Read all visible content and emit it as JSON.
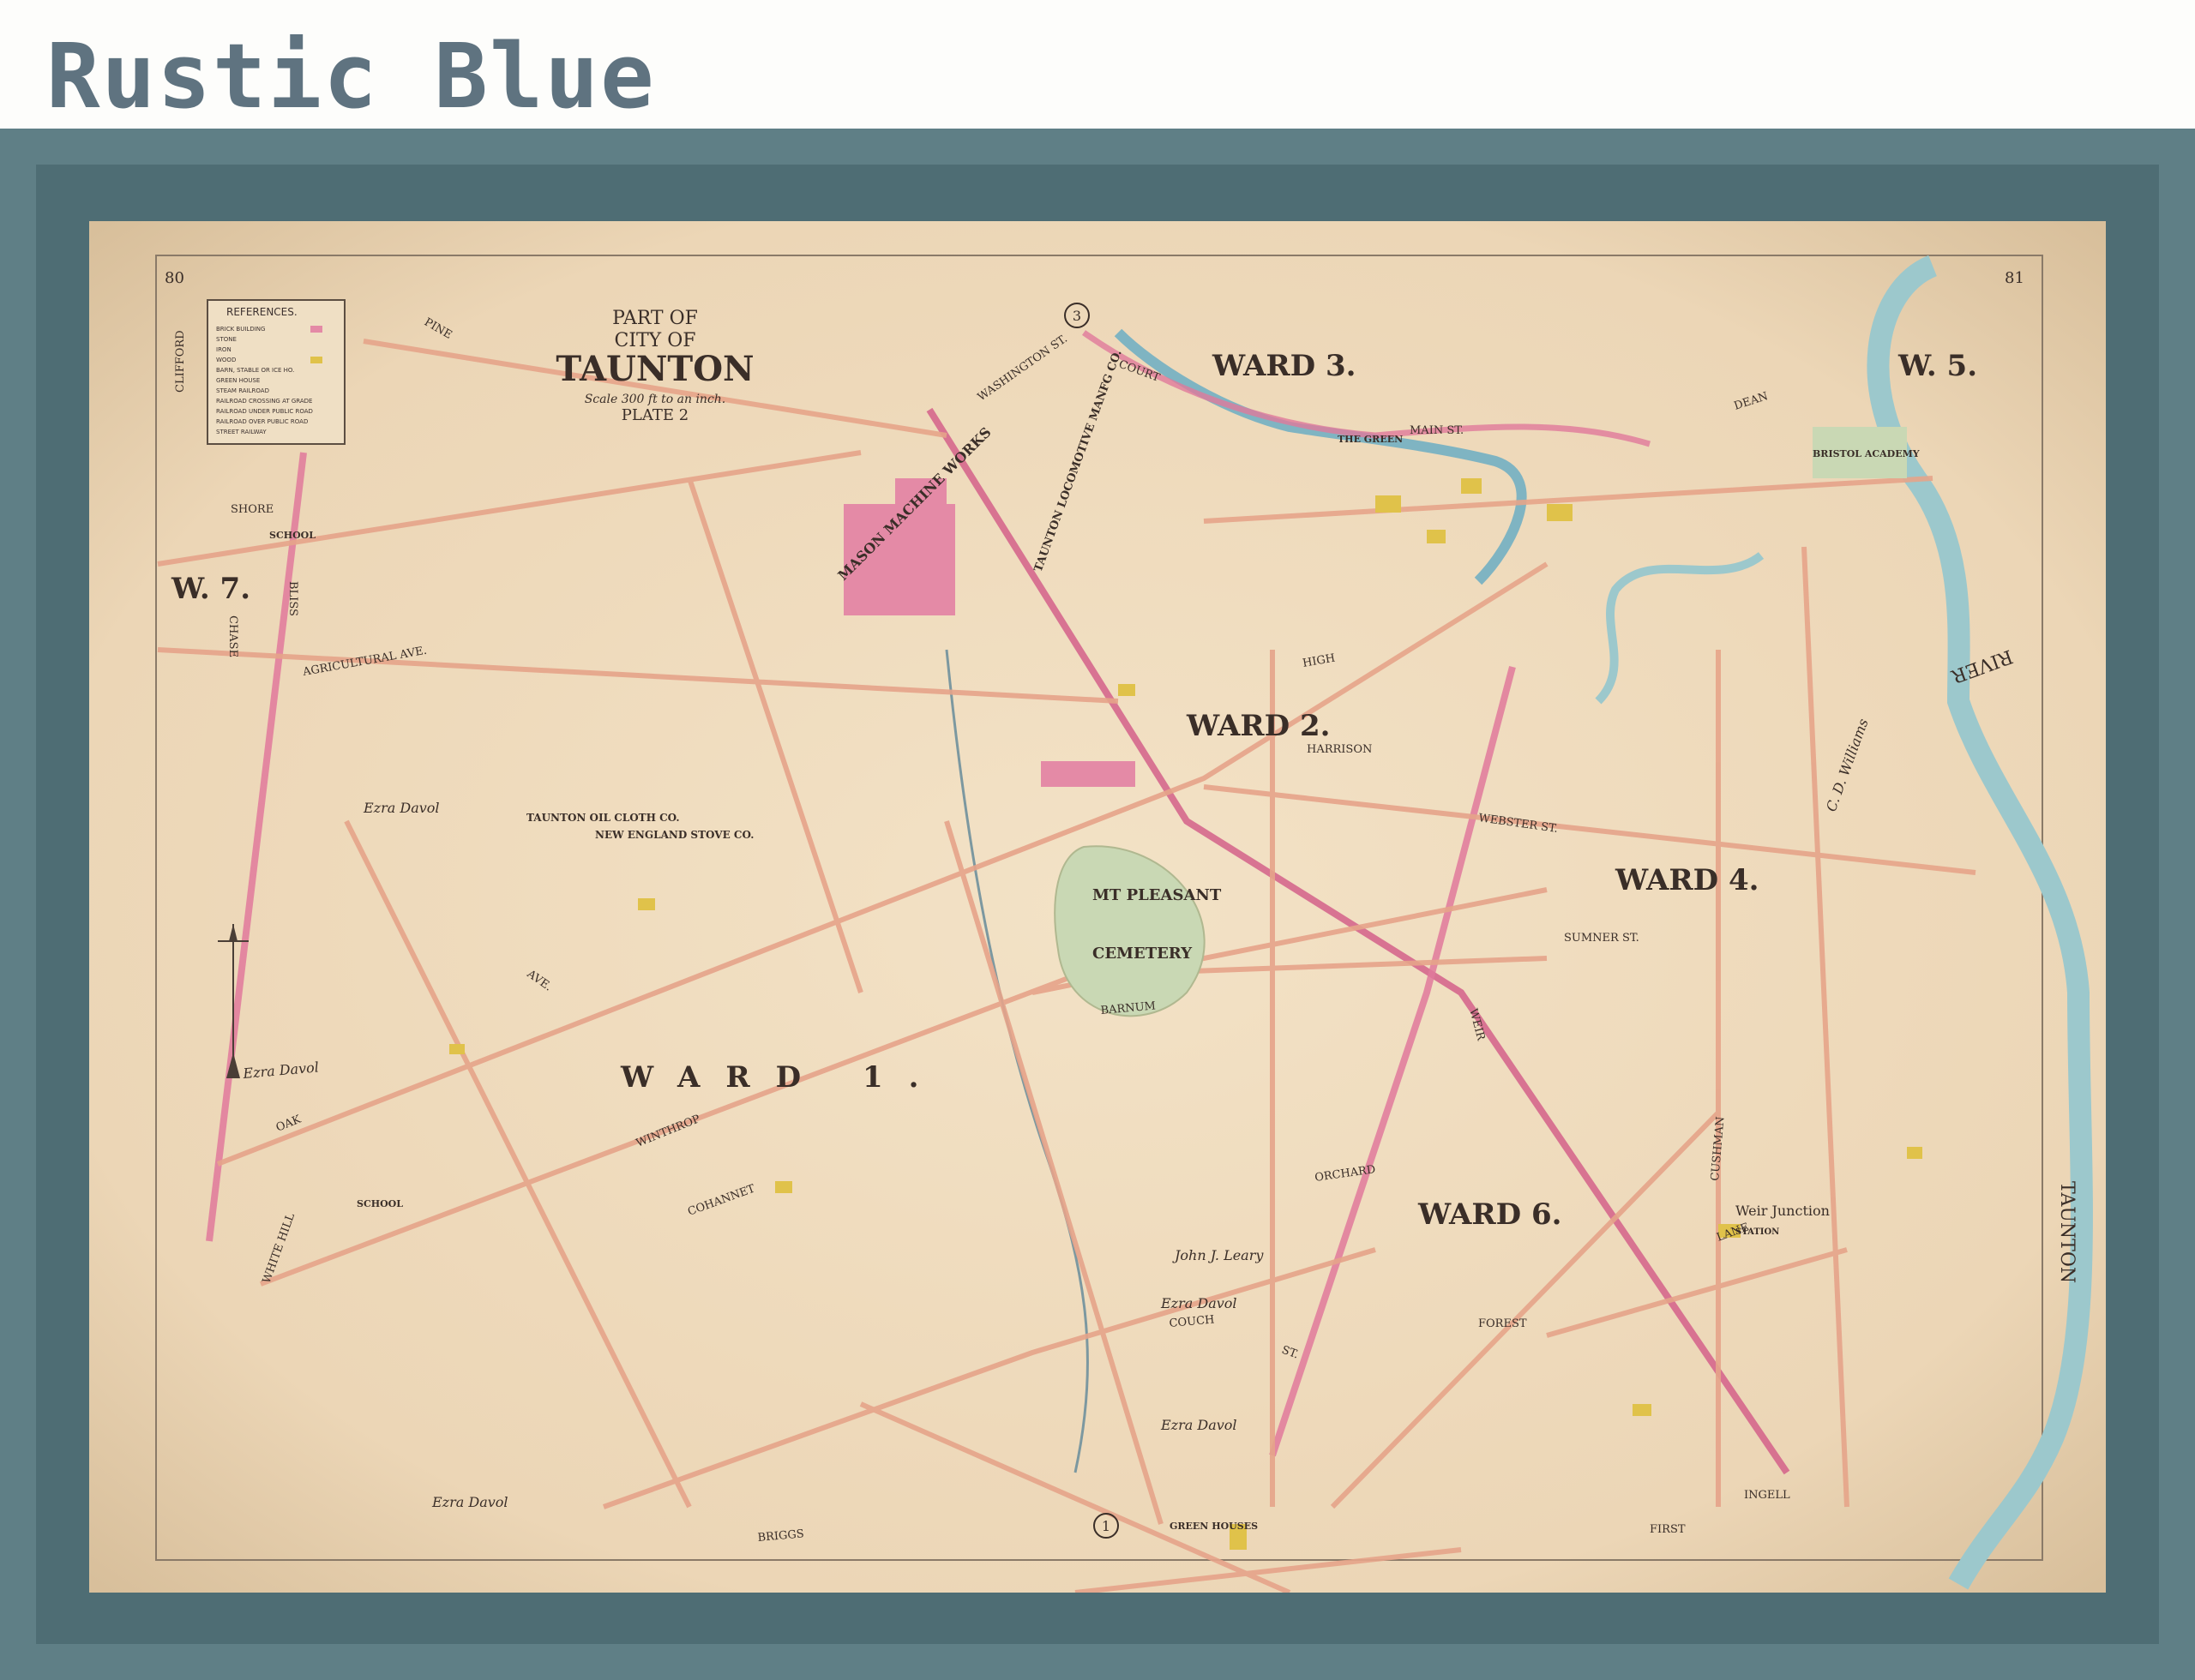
{
  "caption": "Rustic Blue",
  "map": {
    "title_line1": "PART OF",
    "title_line2": "CITY OF",
    "title_line3": "TAUNTON",
    "scale": "Scale 300 ft to an inch.",
    "plate": "PLATE 2",
    "page_left": "80",
    "page_right": "81",
    "legend": {
      "title": "REFERENCES.",
      "items": [
        "BRICK BUILDING",
        "STONE",
        "IRON",
        "WOOD",
        "BARN, STABLE OR ICE HO.",
        "GREEN HOUSE",
        "STEAM RAILROAD",
        "RAILROAD CROSSING AT GRADE",
        "RAILROAD UNDER PUBLIC ROAD",
        "RAILROAD OVER PUBLIC ROAD",
        "STREET RAILWAY"
      ]
    },
    "wards": [
      "WARD 3.",
      "W. 5.",
      "W. 7.",
      "WARD 2.",
      "WARD 4.",
      "WARD 1.",
      "WARD 6."
    ],
    "places": [
      "MASON MACHINE WORKS",
      "TAUNTON LOCOMOTIVE MANFG CO.",
      "BRISTOL ACADEMY",
      "TAUNTON OIL CLOTH CO.",
      "NEW ENGLAND STOVE CO.",
      "MT PLEASANT",
      "CEMETERY",
      "Weir Junction",
      "STATION",
      "SCHOOL",
      "SCHOOL",
      "GREEN HOUSES",
      "THE GREEN"
    ],
    "streets": [
      "PINE",
      "WASHINGTON ST.",
      "COURT",
      "MAIN ST.",
      "DEAN",
      "SHORE",
      "AGRICULTURAL AVE.",
      "OAK",
      "AVE.",
      "HIGH",
      "WINTHROP",
      "HARRISON",
      "WEBSTER ST.",
      "SUMNER ST.",
      "BARNUM",
      "WHITE HILL",
      "COHANNET",
      "ORCHARD",
      "COUCH",
      "ST.",
      "BRIGGS",
      "WEIR",
      "FIRST",
      "INGELL",
      "CUSHMAN",
      "FOREST",
      "LANE",
      "BLISS",
      "CHASE",
      "CLIFFORD"
    ],
    "owners": [
      "Ezra Davol",
      "Ezra Davol",
      "Ezra Davol",
      "Ezra Davol",
      "Ezra Davol",
      "John J. Leary",
      "C. D. Williams"
    ],
    "river_label": "TAUNTON",
    "river_label2": "RIVER",
    "circle_numbers": [
      "3",
      "1"
    ]
  }
}
